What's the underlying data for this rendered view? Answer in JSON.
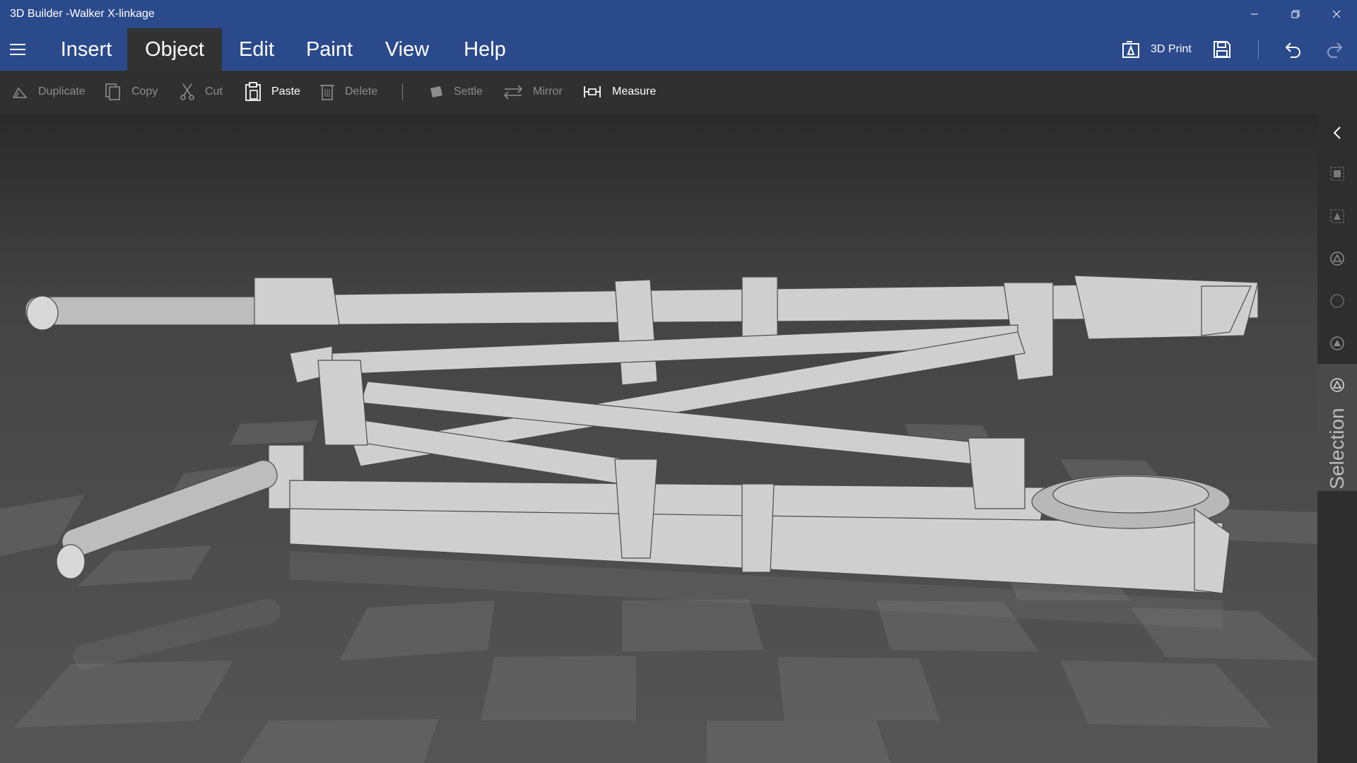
{
  "window": {
    "title": "3D Builder -Walker X-linkage"
  },
  "ribbon": {
    "tabs": [
      {
        "label": "Insert"
      },
      {
        "label": "Object"
      },
      {
        "label": "Edit"
      },
      {
        "label": "Paint"
      },
      {
        "label": "View"
      },
      {
        "label": "Help"
      }
    ],
    "active_tab": "Object",
    "print_label": "3D Print"
  },
  "toolbar": {
    "duplicate": "Duplicate",
    "copy": "Copy",
    "cut": "Cut",
    "paste": "Paste",
    "delete": "Delete",
    "settle": "Settle",
    "mirror": "Mirror",
    "measure": "Measure"
  },
  "side_panel": {
    "selection_label": "Selection"
  },
  "colors": {
    "accent": "#2b4a8c",
    "toolbar_bg": "#303030",
    "active_tab_bg": "#323232",
    "disabled_text": "#8d8d8d"
  },
  "icons": [
    "hamburger-icon",
    "print-3d-icon",
    "save-icon",
    "undo-icon",
    "redo-icon",
    "minimize-icon",
    "restore-icon",
    "close-icon",
    "duplicate-icon",
    "copy-icon",
    "cut-icon",
    "paste-icon",
    "delete-icon",
    "settle-icon",
    "mirror-icon",
    "measure-icon",
    "collapse-panel-icon",
    "selection-icon"
  ]
}
